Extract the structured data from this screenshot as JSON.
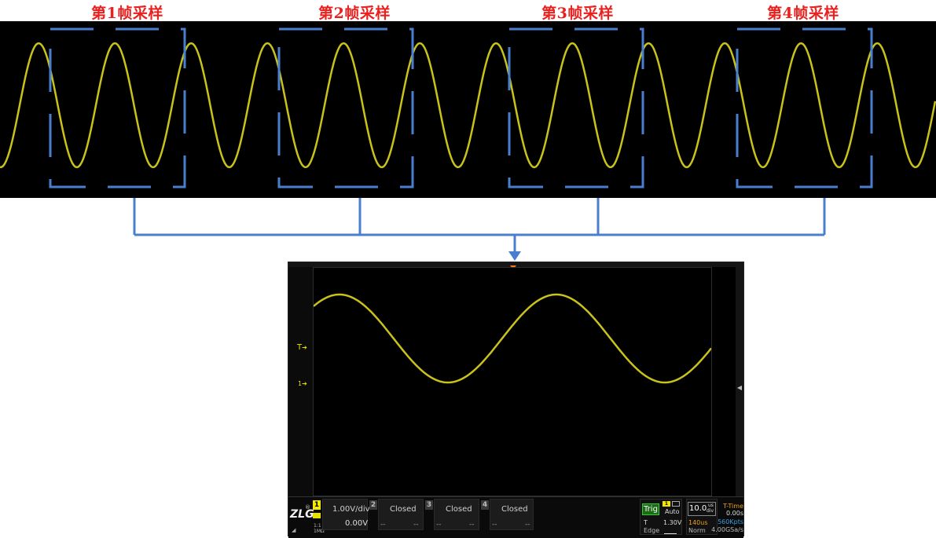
{
  "frames": [
    {
      "label": "第1帧采样"
    },
    {
      "label": "第2帧采样"
    },
    {
      "label": "第3帧采样"
    },
    {
      "label": "第4帧采样"
    }
  ],
  "colors": {
    "waveform": "#c9c21a",
    "frame_box": "#4a7fd0",
    "label": "#e8201e",
    "connector": "#4a7fd0"
  },
  "scope": {
    "markers": {
      "trigger_level": "T",
      "channel1": "1"
    },
    "channels": [
      {
        "num": "1",
        "scale": "1.00V/div",
        "offset": "0.00V",
        "coupling": "1:1",
        "impedance": "1MΩ"
      },
      {
        "num": "2",
        "status": "Closed",
        "a": "--",
        "b": "--"
      },
      {
        "num": "3",
        "status": "Closed",
        "a": "--",
        "b": "--"
      },
      {
        "num": "4",
        "status": "Closed",
        "a": "--",
        "b": "--"
      }
    ],
    "trigger": {
      "label": "Trig",
      "source": "1",
      "mode": "Auto",
      "type_label": "T",
      "level": "1.30V",
      "slope": "Edge"
    },
    "timebase": {
      "value": "10.0",
      "unit_top": "us",
      "unit_bottom": "div",
      "delay": "140us",
      "acq_mode": "Norm"
    },
    "time_info": {
      "label": "T-Time",
      "offset": "0.00s",
      "memory": "560Kpts",
      "rate": "4.00GSa/s"
    },
    "waveform_bottom": {
      "cycles": 1.75,
      "amplitude_fraction": 0.38
    }
  }
}
